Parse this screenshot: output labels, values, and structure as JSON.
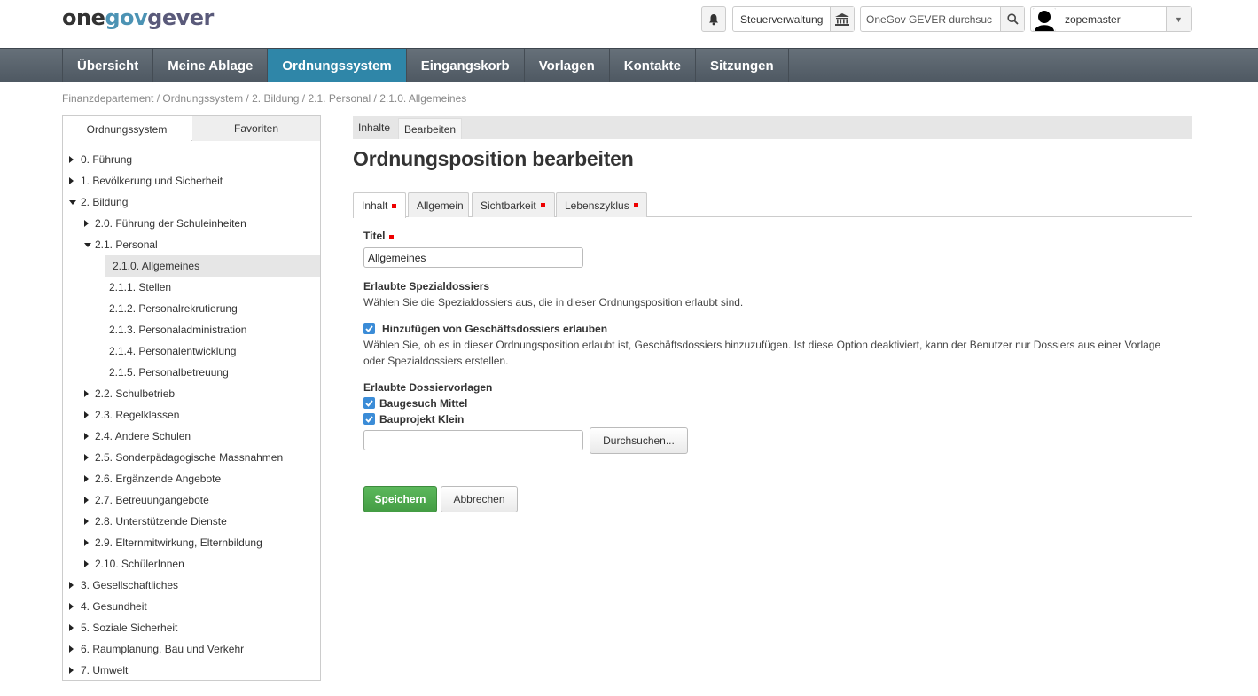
{
  "header": {
    "logo": {
      "one": "one",
      "gov": "gov",
      "gever": "gever"
    },
    "org_unit": "Steuerverwaltung",
    "search_value": "OneGov GEVER durchsuc",
    "user_name": "zopemaster"
  },
  "nav": [
    "Übersicht",
    "Meine Ablage",
    "Ordnungssystem",
    "Eingangskorb",
    "Vorlagen",
    "Kontakte",
    "Sitzungen"
  ],
  "nav_active": "Ordnungssystem",
  "breadcrumb": "Finanzdepartement / Ordnungssystem / 2. Bildung / 2.1. Personal / 2.1.0. Allgemeines",
  "panel": {
    "tabs": [
      "Ordnungssystem",
      "Favoriten"
    ],
    "tree": [
      {
        "label": "0. Führung",
        "level": 0,
        "toggle": "right"
      },
      {
        "label": "1. Bevölkerung und Sicherheit",
        "level": 0,
        "toggle": "right"
      },
      {
        "label": "2. Bildung",
        "level": 0,
        "toggle": "down"
      },
      {
        "label": "2.0. Führung der Schuleinheiten",
        "level": 1,
        "toggle": "right"
      },
      {
        "label": "2.1. Personal",
        "level": 1,
        "toggle": "down"
      },
      {
        "label": "2.1.0. Allgemeines",
        "level": 2,
        "toggle": "none",
        "selected": true
      },
      {
        "label": "2.1.1. Stellen",
        "level": 2,
        "toggle": "none"
      },
      {
        "label": "2.1.2. Personalrekrutierung",
        "level": 2,
        "toggle": "none"
      },
      {
        "label": "2.1.3. Personaladministration",
        "level": 2,
        "toggle": "none"
      },
      {
        "label": "2.1.4. Personalentwicklung",
        "level": 2,
        "toggle": "none"
      },
      {
        "label": "2.1.5. Personalbetreuung",
        "level": 2,
        "toggle": "none"
      },
      {
        "label": "2.2. Schulbetrieb",
        "level": 1,
        "toggle": "right"
      },
      {
        "label": "2.3. Regelklassen",
        "level": 1,
        "toggle": "right"
      },
      {
        "label": "2.4. Andere Schulen",
        "level": 1,
        "toggle": "right"
      },
      {
        "label": "2.5. Sonderpädagogische Massnahmen",
        "level": 1,
        "toggle": "right"
      },
      {
        "label": "2.6. Ergänzende Angebote",
        "level": 1,
        "toggle": "right"
      },
      {
        "label": "2.7. Betreuungangebote",
        "level": 1,
        "toggle": "right"
      },
      {
        "label": "2.8. Unterstützende Dienste",
        "level": 1,
        "toggle": "right"
      },
      {
        "label": "2.9. Elternmitwirkung, Elternbildung",
        "level": 1,
        "toggle": "right"
      },
      {
        "label": "2.10. SchülerInnen",
        "level": 1,
        "toggle": "right"
      },
      {
        "label": "3. Gesellschaftliches",
        "level": 0,
        "toggle": "right"
      },
      {
        "label": "4. Gesundheit",
        "level": 0,
        "toggle": "right"
      },
      {
        "label": "5. Soziale Sicherheit",
        "level": 0,
        "toggle": "right"
      },
      {
        "label": "6. Raumplanung, Bau und Verkehr",
        "level": 0,
        "toggle": "right"
      },
      {
        "label": "7. Umwelt",
        "level": 0,
        "toggle": "right"
      }
    ]
  },
  "content": {
    "view_tabs": [
      "Inhalte",
      "Bearbeiten"
    ],
    "title": "Ordnungsposition bearbeiten",
    "form_tabs": [
      "Inhalt",
      "Allgemein",
      "Sichtbarkeit",
      "Lebenszyklus"
    ],
    "titel_label": "Titel",
    "titel_value": "Allgemeines",
    "spezial_label": "Erlaubte Spezialdossiers",
    "spezial_help": "Wählen Sie die Spezialdossiers aus, die in dieser Ordnungsposition erlaubt sind.",
    "geschaeft_label": "Hinzufügen von Geschäftsdossiers erlauben",
    "geschaeft_help_1": "Wählen Sie, ob es in dieser Ordnungsposition erlaubt ist, Geschäftsdossiers hinzuzufügen. Ist diese Option deaktiviert, kann der Benutzer nur Dossiers aus einer Vorlage",
    "geschaeft_help_2": "oder Spezialdossiers erstellen.",
    "vorlagen_label": "Erlaubte Dossiervorlagen",
    "vorlage_1": "Baugesuch Mittel",
    "vorlage_2": "Bauprojekt Klein",
    "browse_label": "Durchsuchen...",
    "save_label": "Speichern",
    "cancel_label": "Abbrechen"
  },
  "colors": {
    "nav_active": "#2f86a8",
    "primary": "#5cb85c",
    "required": "#e00000",
    "checkbox": "#3b8cd7"
  }
}
